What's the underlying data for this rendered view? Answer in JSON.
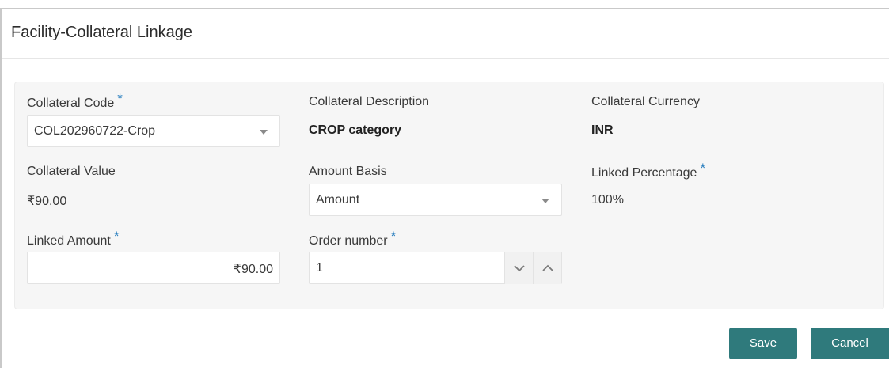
{
  "window": {
    "title": "Facility-Collateral Linkage"
  },
  "form": {
    "collateral_code": {
      "label": "Collateral Code",
      "required_mark": "*",
      "value": "COL202960722-Crop"
    },
    "collateral_description": {
      "label": "Collateral Description",
      "value": "CROP category"
    },
    "collateral_currency": {
      "label": "Collateral Currency",
      "value": "INR"
    },
    "collateral_value": {
      "label": "Collateral Value",
      "value": "₹90.00"
    },
    "amount_basis": {
      "label": "Amount Basis",
      "value": "Amount"
    },
    "linked_percentage": {
      "label": "Linked Percentage",
      "required_mark": "*",
      "value": "100%"
    },
    "linked_amount": {
      "label": "Linked Amount",
      "required_mark": "*",
      "value": "₹90.00"
    },
    "order_number": {
      "label": "Order number",
      "required_mark": "*",
      "value": "1"
    }
  },
  "actions": {
    "save_label": "Save",
    "cancel_label": "Cancel"
  },
  "colors": {
    "accent": "#2f7a7c",
    "required": "#2a7fbf",
    "panel_bg": "#f6f6f6"
  },
  "icons": {
    "dropdown": "chevron-down-icon",
    "stepper_down": "chevron-down-icon",
    "stepper_up": "chevron-up-icon"
  }
}
